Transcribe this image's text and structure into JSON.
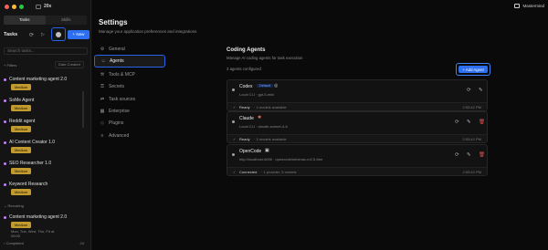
{
  "app": {
    "name": "20x",
    "user": "Mastermind"
  },
  "left": {
    "tabs": [
      {
        "label": "Tasks",
        "active": true
      },
      {
        "label": "Skills",
        "active": false
      }
    ],
    "tasks_title": "Tasks",
    "new_label": "+ New",
    "search_placeholder": "Search tasks...",
    "filters_label": "+ Filters",
    "sort_label": "Date Created",
    "tasks": [
      {
        "name": "Content marketing agent 2.0",
        "badge": "Medium"
      },
      {
        "name": "SoMe Agent",
        "badge": "Medium"
      },
      {
        "name": "Reddit agent",
        "badge": "Medium"
      },
      {
        "name": "AI Content Creator 1.0",
        "badge": "Medium"
      },
      {
        "name": "SEO Researcher 1.0",
        "badge": "Medium"
      },
      {
        "name": "Keyword Research",
        "badge": "Medium"
      }
    ],
    "recurring_label": "Recurring",
    "recurring_task": {
      "name": "Content marketing agent 2.0",
      "badge": "Medium",
      "schedule_line1": "Mon, Tue, Wed, Thu, Fri at",
      "schedule_line2": "09:00"
    },
    "completed_label": "Completed",
    "completed_count": "24"
  },
  "settings": {
    "title": "Settings",
    "subtitle": "Manage your application preferences and integrations",
    "nav": [
      {
        "label": "General",
        "icon": "gear-icon",
        "glyph": "⚙",
        "active": false
      },
      {
        "label": "Agents",
        "icon": "users-icon",
        "glyph": "☺",
        "active": true
      },
      {
        "label": "Tools & MCP",
        "icon": "tool-icon",
        "glyph": "⚒",
        "active": false
      },
      {
        "label": "Secrets",
        "icon": "key-icon",
        "glyph": "⚿",
        "active": false
      },
      {
        "label": "Task sources",
        "icon": "source-icon",
        "glyph": "⇄",
        "active": false
      },
      {
        "label": "Enterprise",
        "icon": "building-icon",
        "glyph": "▦",
        "active": false
      },
      {
        "label": "Plugins",
        "icon": "plugin-icon",
        "glyph": "◇",
        "active": false
      },
      {
        "label": "Advanced",
        "icon": "sliders-icon",
        "glyph": "≡",
        "active": false
      }
    ],
    "panel": {
      "title": "Coding Agents",
      "subtitle": "Manage AI coding agents for task execution",
      "configured": "3 agents configured",
      "add_label": "+ Add Agent",
      "agents": [
        {
          "name": "Codex",
          "default_label": "Default",
          "desc": "Local CLI · gpt-5-mini",
          "status": "Ready",
          "status_detail": "· 4 models available",
          "time": "2:53:42 PM",
          "deletable": false
        },
        {
          "name": "Claude",
          "default_label": "",
          "desc": "Local CLI · claude-sonnet-4-6",
          "status": "Ready",
          "status_detail": "· 3 models available",
          "time": "2:53:42 PM",
          "deletable": true
        },
        {
          "name": "OpenCode",
          "default_label": "",
          "desc": "http://localhost:4096 · opencode/minimax-m2.5-free",
          "status": "Connected",
          "status_detail": "· 1 provider, 5 models",
          "time": "2:53:42 PM",
          "deletable": true
        }
      ]
    }
  },
  "colors": {
    "accent": "#2d6ff2",
    "badge": "#c39a2e",
    "task_dot": "#c084fc",
    "danger": "#e05252"
  }
}
